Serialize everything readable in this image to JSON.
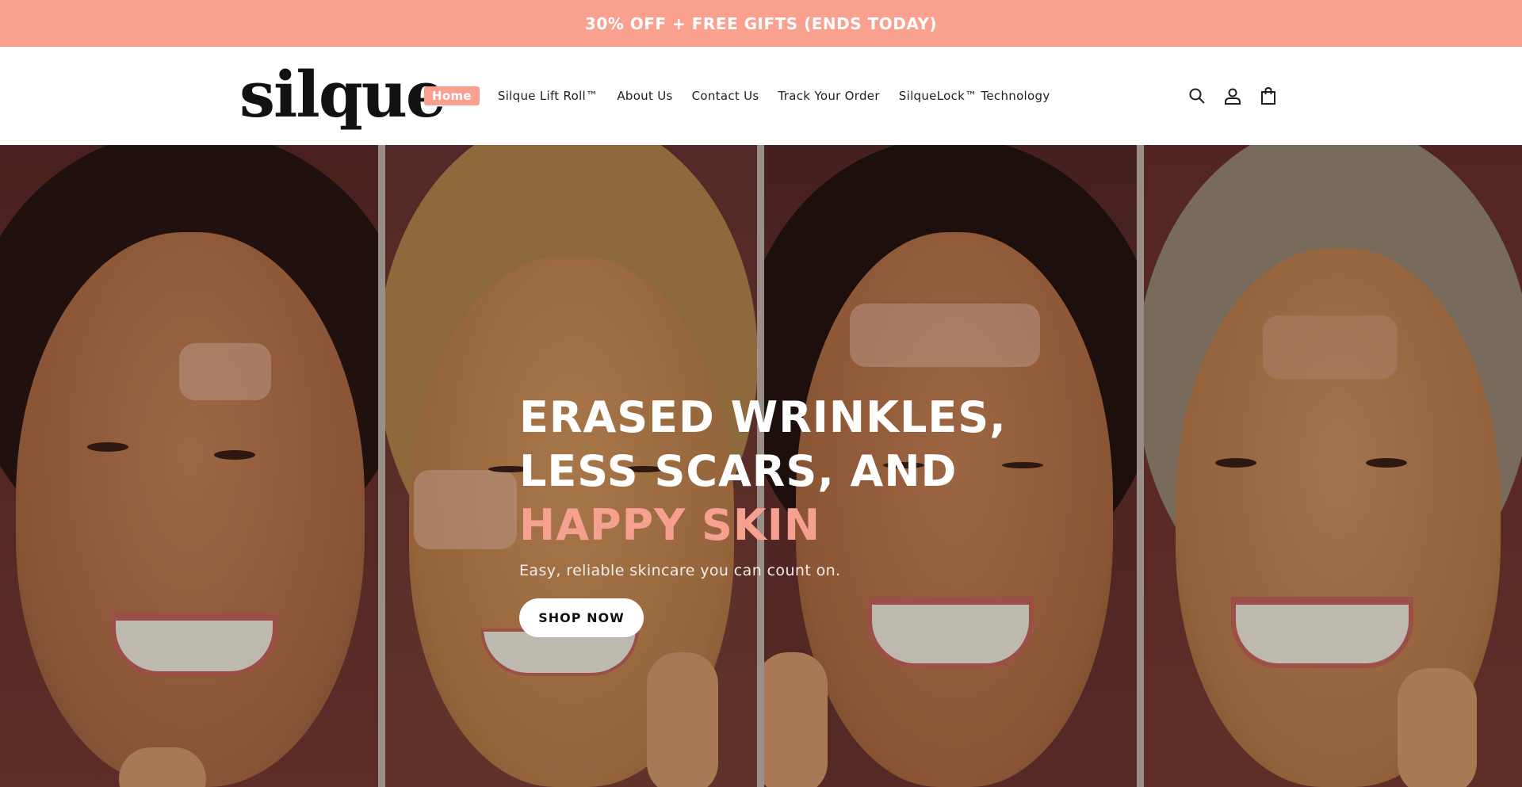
{
  "announcement": {
    "text": "30% OFF + FREE GIFTS (ENDS TODAY)"
  },
  "header": {
    "logo": "silque",
    "nav": [
      {
        "label": "Home",
        "active": true
      },
      {
        "label": "Silque Lift Roll™",
        "active": false
      },
      {
        "label": "About Us",
        "active": false
      },
      {
        "label": "Contact Us",
        "active": false
      },
      {
        "label": "Track Your Order",
        "active": false
      },
      {
        "label": "SilqueLock™ Technology",
        "active": false
      }
    ],
    "icons": [
      "search-icon",
      "account-icon",
      "cart-icon"
    ]
  },
  "hero": {
    "title_line1": "ERASED WRINKLES,",
    "title_line2": "LESS SCARS, AND",
    "title_line3": "HAPPY SKIN",
    "subtitle": "Easy, reliable skincare you can count on.",
    "cta": "SHOP NOW"
  },
  "colors": {
    "accent": "#f9a08f",
    "heading_accent": "#f6a190",
    "text_dark": "#121212"
  }
}
